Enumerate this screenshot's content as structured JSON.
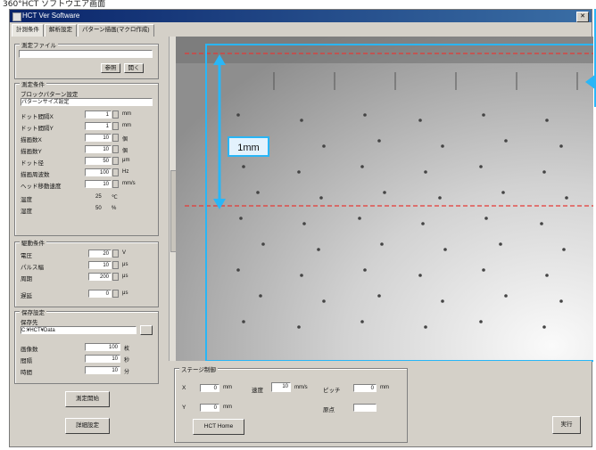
{
  "caption": "360°HCT ソフトウエア画面",
  "window": {
    "title": "HCT Ver Software",
    "close": "✕"
  },
  "tabs": [
    {
      "label": "計測条件"
    },
    {
      "label": "解析設定"
    },
    {
      "label": "パターン描画(マクロ作成)"
    }
  ],
  "left": {
    "file_group": {
      "label": "測定ファイル",
      "path": "",
      "btn1": "参照",
      "btn2": "開く"
    },
    "cond_group": {
      "label": "測定条件",
      "sub1": "ブロックパターン設定",
      "sub2": "パターンサイズ設定",
      "rows": [
        {
          "label": "ドット間隔X",
          "value": "1",
          "unit": "mm"
        },
        {
          "label": "ドット間隔Y",
          "value": "1",
          "unit": "mm"
        },
        {
          "label": "描画数X",
          "value": "10",
          "unit": "個"
        },
        {
          "label": "描画数Y",
          "value": "10",
          "unit": "個"
        },
        {
          "label": "ドット径",
          "value": "50",
          "unit": "μm"
        },
        {
          "label": "描画周波数",
          "value": "100",
          "unit": "Hz"
        },
        {
          "label": "ヘッド移動速度",
          "value": "10",
          "unit": "mm/s"
        },
        {
          "label": "温度",
          "value": "25",
          "unit": "℃"
        },
        {
          "label": "湿度",
          "value": "50",
          "unit": "%"
        }
      ]
    },
    "drive_group": {
      "label": "駆動条件",
      "rows": [
        {
          "label": "電圧",
          "value": "20",
          "unit": "V"
        },
        {
          "label": "パルス幅",
          "value": "10",
          "unit": "μs"
        },
        {
          "label": "周期",
          "value": "200",
          "unit": "μs"
        },
        {
          "label": "遅延",
          "value": "0",
          "unit": "μs"
        }
      ]
    },
    "save_group": {
      "label": "保存設定",
      "sub": "保存先",
      "path": "C:¥HCT¥Data",
      "rows": [
        {
          "label": "画像数",
          "value": "100",
          "unit": "枚"
        },
        {
          "label": "間隔",
          "value": "10",
          "unit": "秒"
        },
        {
          "label": "時間",
          "value": "10",
          "unit": "分"
        }
      ]
    },
    "start_button": "測定開始",
    "settings_button": "詳細設定"
  },
  "viewer": {
    "scale_label": "1mm"
  },
  "bottom": {
    "group_label": "ステージ制御",
    "x_label": "X",
    "x_value": "0",
    "x_unit": "mm",
    "speed_label": "速度",
    "speed_value": "10",
    "speed_unit": "mm/s",
    "pitch_label": "ピッチ",
    "pitch_value": "0",
    "pitch_unit": "mm",
    "y_label": "Y",
    "y_value": "0",
    "y_unit": "mm",
    "origin_label": "原点",
    "origin_value": "",
    "home_button": "HCT Home",
    "right_button": "実行"
  },
  "colors": {
    "accent": "#29b6f6",
    "guide": "#e53935"
  }
}
